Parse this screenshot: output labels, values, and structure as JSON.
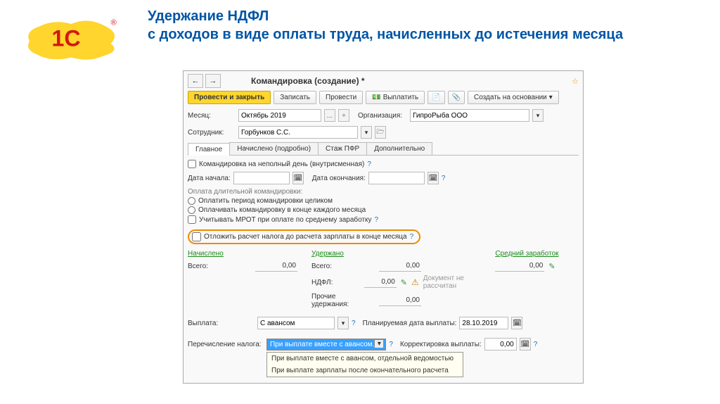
{
  "slide": {
    "title": "Удержание НДФЛ\nс доходов в виде оплаты труда, начисленных до истечения месяца"
  },
  "nav": {
    "back": "←",
    "fwd": "→",
    "star": "☆"
  },
  "window": {
    "title": "Командировка (создание) *"
  },
  "toolbar": {
    "primary": "Провести и закрыть",
    "save": "Записать",
    "post": "Провести",
    "pay": "Выплатить",
    "create_on": "Создать на основании"
  },
  "header": {
    "month_lbl": "Месяц:",
    "month_val": "Октябрь 2019",
    "org_lbl": "Организация:",
    "org_val": "ГипроРыба ООО",
    "emp_lbl": "Сотрудник:",
    "emp_val": "Горбунков С.С."
  },
  "tabs": {
    "main": "Главное",
    "accrued": "Начислено (подробно)",
    "pfr": "Стаж ПФР",
    "extra": "Дополнительно"
  },
  "body": {
    "partday": "Командировка на неполный день (внутрисменная)",
    "date_from": "Дата начала:",
    "date_to": "Дата окончания:",
    "long_trip": "Оплата длительной командировки:",
    "opt_whole": "Оплатить период командировки целиком",
    "opt_monthly": "Оплачивать командировку в конце каждого месяца",
    "mrot": "Учитывать МРОТ при оплате по среднему заработку",
    "defer": "Отложить расчет налога до расчета зарплаты в конце месяца"
  },
  "sums": {
    "accrued_h": "Начислено",
    "withheld_h": "Удержано",
    "avg_h": "Средний заработок",
    "total": "Всего:",
    "ndfl": "НДФЛ:",
    "other": "Прочие удержания:",
    "zero": "0,00",
    "not_calc": "Документ не рассчитан"
  },
  "payout": {
    "lbl": "Выплата:",
    "val": "С авансом",
    "plan_lbl": "Планируемая дата выплаты:",
    "plan_val": "28.10.2019"
  },
  "tax": {
    "lbl": "Перечисление налога:",
    "selected": "При выплате вместе с авансом.",
    "opt1": "При выплате вместе с авансом, отдельной ведомостью",
    "opt2": "При выплате зарплаты после окончательного расчета",
    "corr_lbl": "Корректировка выплаты:",
    "corr_val": "0,00"
  },
  "glyph": {
    "help": "?",
    "dots": "…",
    "down": "÷",
    "cal": "📅",
    "dd": "▾",
    "open": "🗁",
    "doc": "📄",
    "clip": "📎",
    "pencil": "✎",
    "warn": "⚠"
  }
}
